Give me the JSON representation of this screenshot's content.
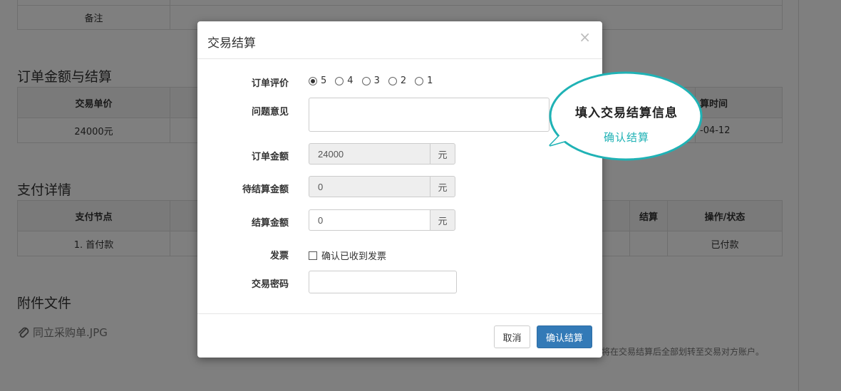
{
  "background": {
    "remark_label": "备注",
    "section_amount_title": "订单金额与结算",
    "amount_table": {
      "headers": [
        "交易单价",
        "算时间"
      ],
      "row": [
        "24000元",
        "-04-12"
      ]
    },
    "section_payment_title": "支付详情",
    "payment_table": {
      "headers": [
        "支付节点",
        "结算",
        "操作/状态"
      ],
      "row": [
        "1. 首付款",
        "",
        "已付款"
      ]
    },
    "section_attach_title": "附件文件",
    "attachment_name": "同立采购单.JPG",
    "attachment_icon": "paperclip-icon",
    "bottom_note": "将在交易结算后全部划转至交易对方账户。"
  },
  "modal": {
    "title": "交易结算",
    "close_label": "×",
    "rating": {
      "label": "订单评价",
      "options": [
        "5",
        "4",
        "3",
        "2",
        "1"
      ],
      "selected": "5"
    },
    "issue": {
      "label": "问题意见",
      "value": ""
    },
    "order_amount": {
      "label": "订单金额",
      "value": "24000",
      "unit": "元"
    },
    "pending_amount": {
      "label": "待结算金额",
      "value": "0",
      "unit": "元"
    },
    "settle_amount": {
      "label": "结算金额",
      "value": "0",
      "unit": "元"
    },
    "invoice": {
      "label": "发票",
      "checkbox_label": "确认已收到发票",
      "checked": false
    },
    "password": {
      "label": "交易密码",
      "value": ""
    },
    "cancel_label": "取消",
    "confirm_label": "确认结算",
    "confirm_color": "#337ab7"
  },
  "callout": {
    "line1": "填入交易结算信息",
    "line2": "确认结算",
    "border_color": "#1fb2b5"
  }
}
